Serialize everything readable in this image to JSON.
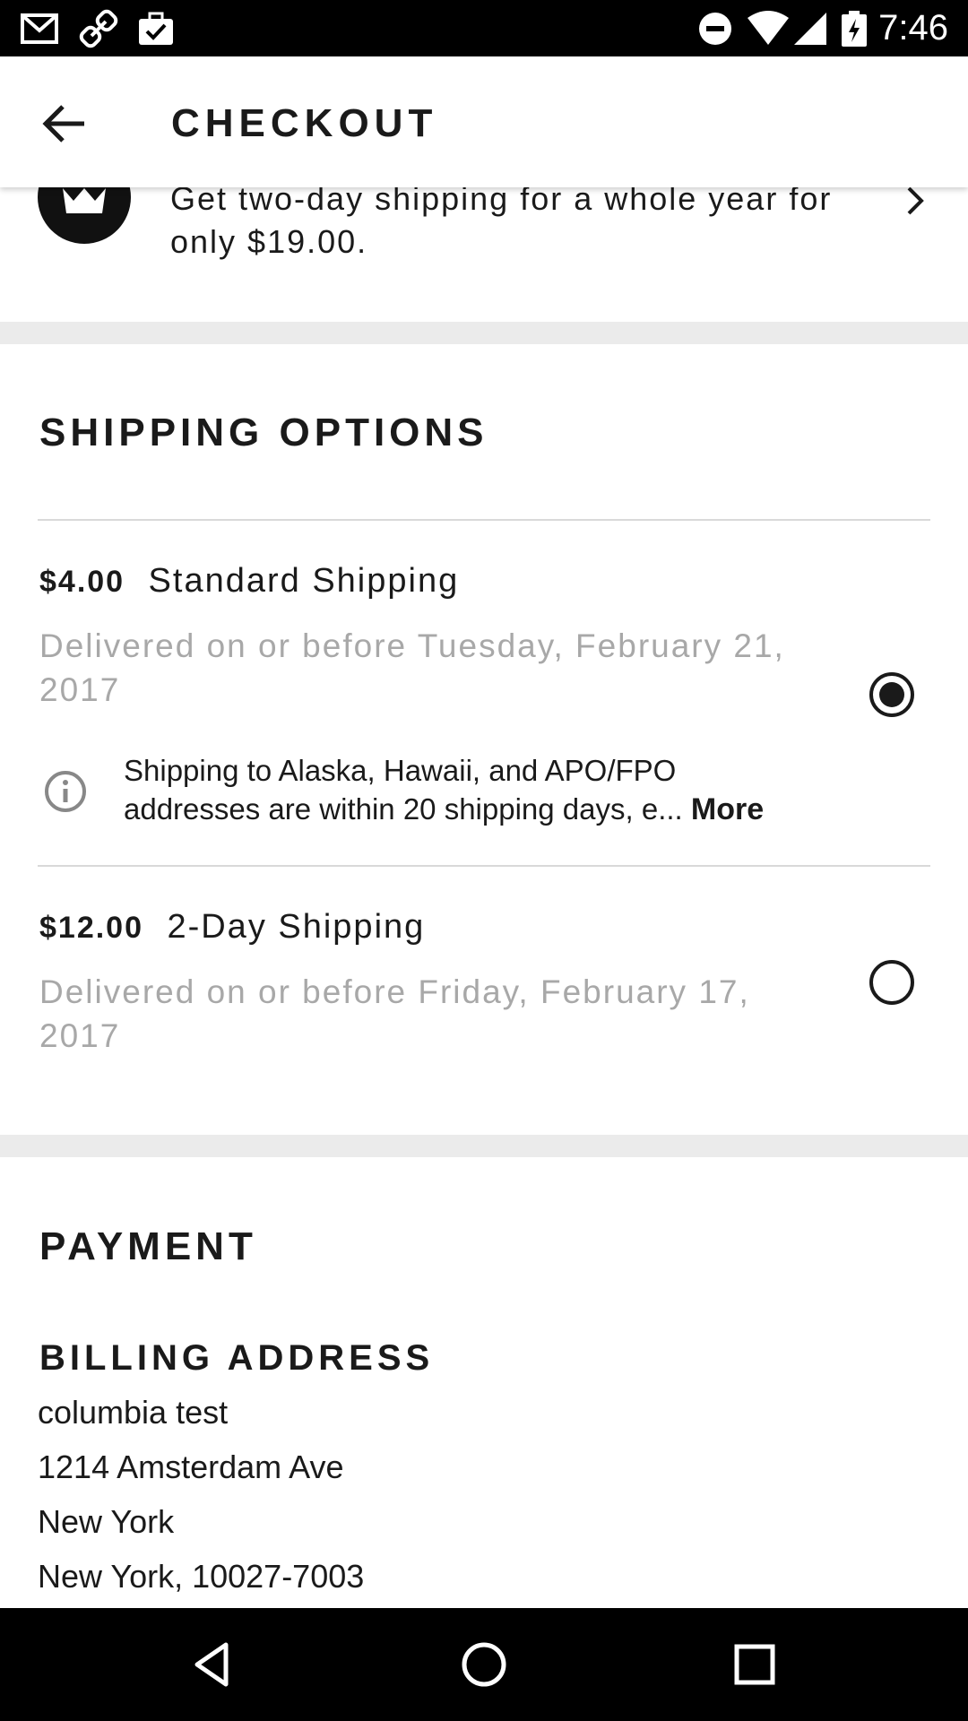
{
  "status_bar": {
    "time": "7:46",
    "left_icons": [
      "gmail-icon",
      "link-icon",
      "briefcase-check-icon"
    ],
    "right_icons": [
      "do-not-disturb-icon",
      "wifi-icon",
      "signal-icon",
      "battery-charging-icon"
    ]
  },
  "app_bar": {
    "title": "CHECKOUT",
    "back_icon": "arrow-left-icon"
  },
  "promo": {
    "text_line1": "Get two-day shipping for a whole year for",
    "text_line2": "only $19.00.",
    "chevron_icon": "chevron-right-icon"
  },
  "shipping": {
    "title": "SHIPPING OPTIONS",
    "options": [
      {
        "price": "$4.00",
        "name": "Standard Shipping",
        "delivery_line1": "Delivered on or before Tuesday, February 21,",
        "delivery_line2": "2017",
        "selected": true
      },
      {
        "price": "$12.00",
        "name": "2-Day Shipping",
        "delivery_line1": "Delivered on or before Friday, February 17,",
        "delivery_line2": "2017",
        "selected": false
      }
    ],
    "info": {
      "line1": "Shipping to Alaska, Hawaii, and APO/FPO",
      "line2": "addresses are within 20 shipping days, e...",
      "more": "More"
    }
  },
  "payment": {
    "title": "PAYMENT",
    "billing_title": "BILLING ADDRESS",
    "address_lines": [
      "columbia test",
      "1214 Amsterdam Ave",
      "New York",
      "New York, 10027-7003"
    ]
  },
  "nav_bar": {
    "icons": [
      "back-triangle-icon",
      "home-circle-icon",
      "recents-square-icon"
    ]
  },
  "colors": {
    "text": "#1a1a1a",
    "muted": "#a8a8a8",
    "divider": "#ebebeb",
    "bars": "#000000"
  }
}
